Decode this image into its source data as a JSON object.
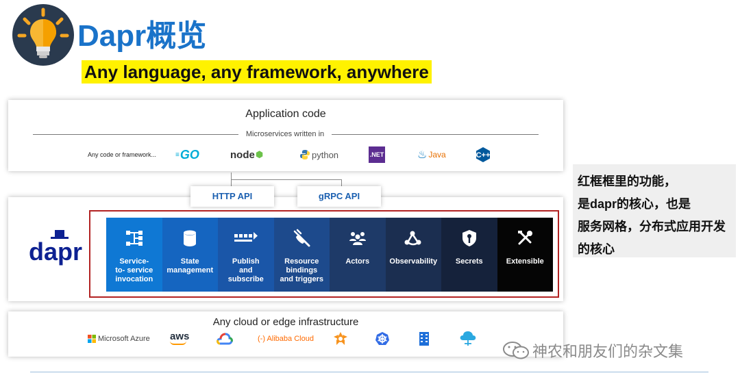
{
  "header": {
    "title": "Dapr概览",
    "subtitle": "Any language, any framework, anywhere"
  },
  "app": {
    "title": "Application code",
    "ms_label": "Microservices written in",
    "langs": [
      {
        "name": "Any code or framework...",
        "color": "#222"
      },
      {
        "name": "GO",
        "color": "#00acd7"
      },
      {
        "name": "node",
        "color": "#333"
      },
      {
        "name": "python",
        "color": "#555"
      },
      {
        "name": ".NET",
        "color": "#ffffff"
      },
      {
        "name": "Java",
        "color": "#e76f00"
      },
      {
        "name": "C++",
        "color": "#00599c"
      }
    ]
  },
  "apis": {
    "http": "HTTP API",
    "grpc": "gRPC API"
  },
  "dapr": {
    "logo_text": "dapr",
    "tiles": [
      {
        "label": "Service-\nto- service\ninvocation",
        "icon": "service-invocation-icon",
        "color": "#0f78d4"
      },
      {
        "label": "State\nmanagement",
        "icon": "state-database-icon",
        "color": "#1565c0"
      },
      {
        "label": "Publish\nand\nsubscribe",
        "icon": "pubsub-icon",
        "color": "#1a56a8"
      },
      {
        "label": "Resource\nbindings\nand triggers",
        "icon": "plug-icon",
        "color": "#1d4a8c"
      },
      {
        "label": "Actors",
        "icon": "actors-icon",
        "color": "#1e3a68"
      },
      {
        "label": "Observability",
        "icon": "observability-icon",
        "color": "#1b2e50"
      },
      {
        "label": "Secrets",
        "icon": "shield-key-icon",
        "color": "#15223b"
      },
      {
        "label": "Extensible",
        "icon": "tools-icon",
        "color": "#050505"
      }
    ]
  },
  "cloud": {
    "title": "Any cloud or edge infrastructure",
    "items": [
      {
        "name": "Microsoft Azure",
        "color": "#444"
      },
      {
        "name": "aws",
        "color": "#232f3e"
      },
      {
        "name": "",
        "icon": "google-cloud-icon"
      },
      {
        "name": "(-) Alibaba Cloud",
        "color": "#ff6a00"
      },
      {
        "name": "",
        "icon": "helm-icon"
      },
      {
        "name": "",
        "icon": "kubernetes-icon"
      },
      {
        "name": "",
        "icon": "building-icon"
      },
      {
        "name": "",
        "icon": "edge-cloud-icon"
      }
    ]
  },
  "note": {
    "lines": [
      "红框框里的功能，",
      "是dapr的核心，也是",
      "服务网格，分布式应用开发",
      "的核心"
    ]
  },
  "watermark": "神农和朋友们的杂文集",
  "colors": {
    "title_blue": "#1a73c9",
    "highlight": "#fff200",
    "frame_red": "#b22222"
  }
}
